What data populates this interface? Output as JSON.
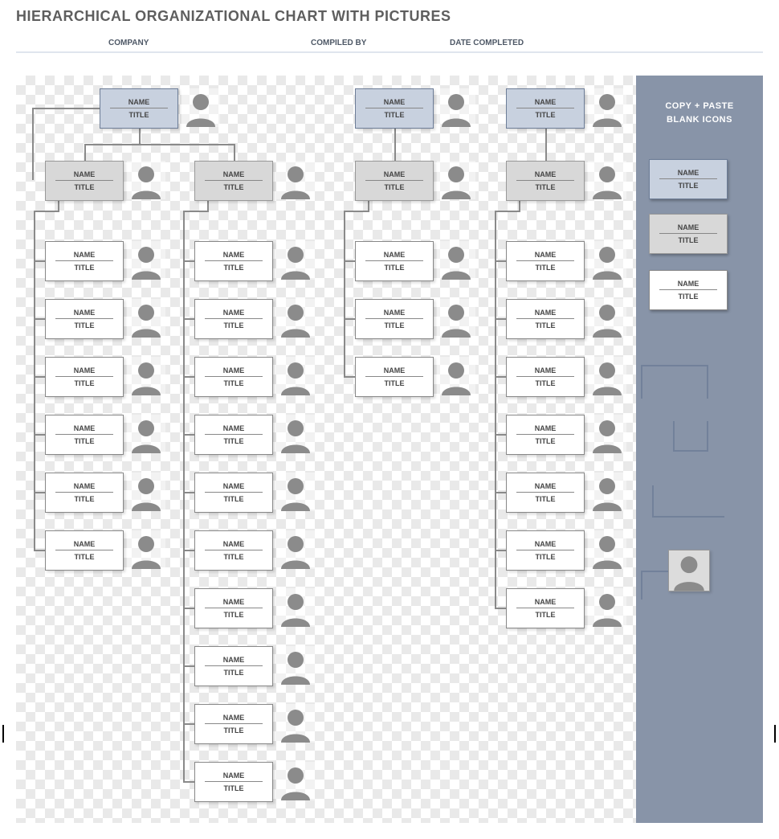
{
  "title": "HIERARCHICAL ORGANIZATIONAL CHART WITH PICTURES",
  "header": {
    "company": "COMPANY",
    "compiled_by": "COMPILED BY",
    "date_completed": "DATE COMPLETED"
  },
  "sidebar": {
    "title_line1": "COPY + PASTE",
    "title_line2": "BLANK ICONS",
    "sample_top": {
      "name": "NAME",
      "title": "TITLE"
    },
    "sample_mid": {
      "name": "NAME",
      "title": "TITLE"
    },
    "sample_leaf": {
      "name": "NAME",
      "title": "TITLE"
    }
  },
  "cards": {
    "default": {
      "name": "NAME",
      "title": "TITLE"
    }
  },
  "chart_data": {
    "type": "tree",
    "note": "template screenshot — all nodes show placeholder NAME/TITLE",
    "roots": [
      {
        "id": "A",
        "name": "NAME",
        "title": "TITLE",
        "children": [
          {
            "id": "A1",
            "name": "NAME",
            "title": "TITLE",
            "children": [
              {
                "id": "A1a",
                "name": "NAME",
                "title": "TITLE"
              },
              {
                "id": "A1b",
                "name": "NAME",
                "title": "TITLE"
              },
              {
                "id": "A1c",
                "name": "NAME",
                "title": "TITLE"
              },
              {
                "id": "A1d",
                "name": "NAME",
                "title": "TITLE"
              },
              {
                "id": "A1e",
                "name": "NAME",
                "title": "TITLE"
              },
              {
                "id": "A1f",
                "name": "NAME",
                "title": "TITLE"
              }
            ]
          },
          {
            "id": "A2",
            "name": "NAME",
            "title": "TITLE",
            "children": [
              {
                "id": "A2a",
                "name": "NAME",
                "title": "TITLE"
              },
              {
                "id": "A2b",
                "name": "NAME",
                "title": "TITLE"
              },
              {
                "id": "A2c",
                "name": "NAME",
                "title": "TITLE"
              },
              {
                "id": "A2d",
                "name": "NAME",
                "title": "TITLE"
              },
              {
                "id": "A2e",
                "name": "NAME",
                "title": "TITLE"
              },
              {
                "id": "A2f",
                "name": "NAME",
                "title": "TITLE"
              },
              {
                "id": "A2g",
                "name": "NAME",
                "title": "TITLE"
              },
              {
                "id": "A2h",
                "name": "NAME",
                "title": "TITLE"
              },
              {
                "id": "A2i",
                "name": "NAME",
                "title": "TITLE"
              },
              {
                "id": "A2j",
                "name": "NAME",
                "title": "TITLE"
              }
            ]
          }
        ]
      },
      {
        "id": "B",
        "name": "NAME",
        "title": "TITLE",
        "children": [
          {
            "id": "B1",
            "name": "NAME",
            "title": "TITLE",
            "children": [
              {
                "id": "B1a",
                "name": "NAME",
                "title": "TITLE"
              },
              {
                "id": "B1b",
                "name": "NAME",
                "title": "TITLE"
              },
              {
                "id": "B1c",
                "name": "NAME",
                "title": "TITLE"
              }
            ]
          }
        ]
      },
      {
        "id": "C",
        "name": "NAME",
        "title": "TITLE",
        "children": [
          {
            "id": "C1",
            "name": "NAME",
            "title": "TITLE",
            "children": [
              {
                "id": "C1a",
                "name": "NAME",
                "title": "TITLE"
              },
              {
                "id": "C1b",
                "name": "NAME",
                "title": "TITLE"
              },
              {
                "id": "C1c",
                "name": "NAME",
                "title": "TITLE"
              },
              {
                "id": "C1d",
                "name": "NAME",
                "title": "TITLE"
              },
              {
                "id": "C1e",
                "name": "NAME",
                "title": "TITLE"
              },
              {
                "id": "C1f",
                "name": "NAME",
                "title": "TITLE"
              },
              {
                "id": "C1g",
                "name": "NAME",
                "title": "TITLE"
              }
            ]
          }
        ]
      }
    ]
  }
}
